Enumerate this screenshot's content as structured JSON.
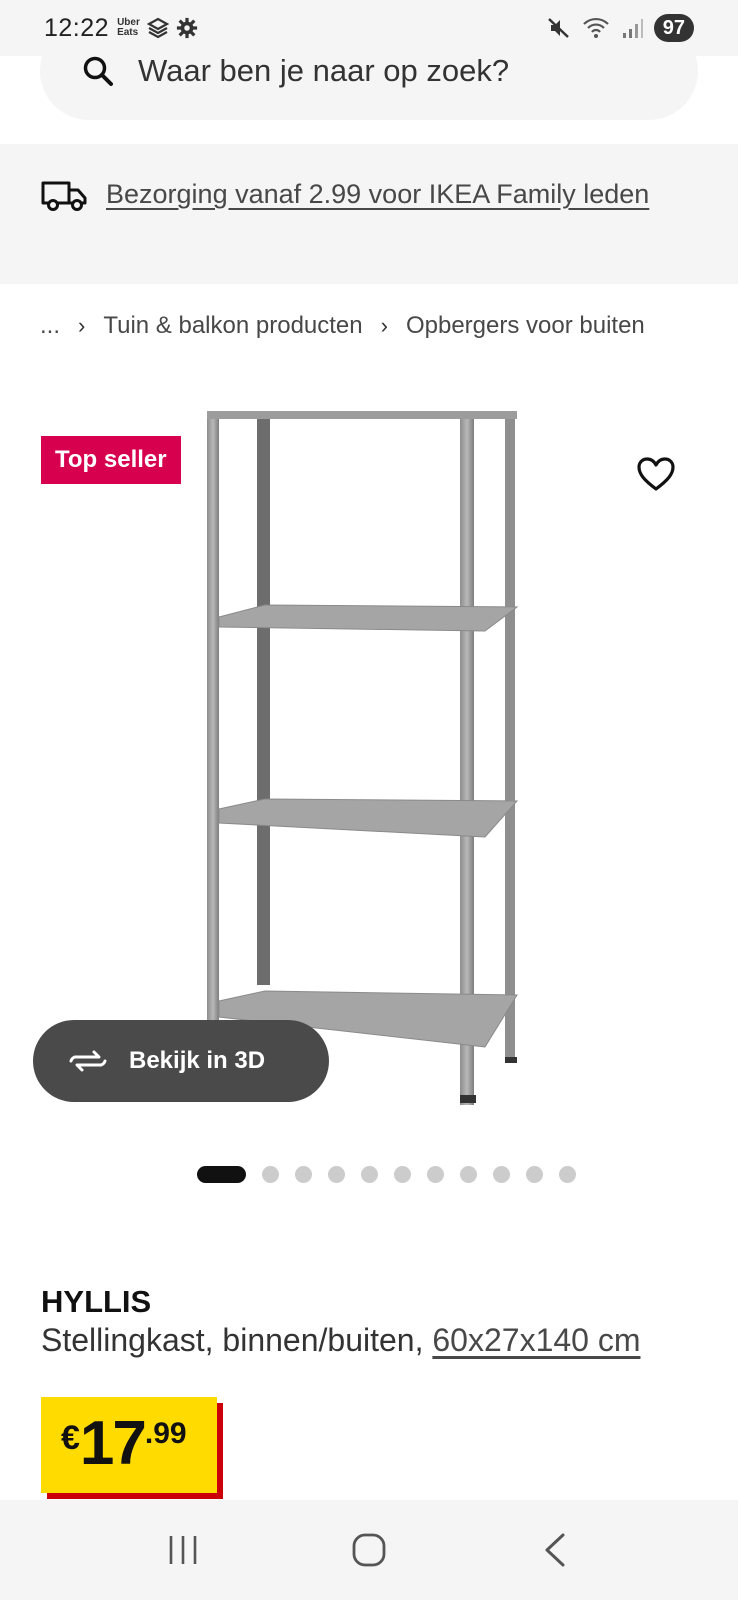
{
  "status_bar": {
    "time": "12:22",
    "notif_app": "Uber\nEats",
    "battery": "97"
  },
  "search": {
    "placeholder": "Waar ben je naar op zoek?"
  },
  "banner": {
    "text": "Bezorging vanaf 2.99 voor IKEA Family leden",
    "icon": "delivery-truck-icon"
  },
  "breadcrumb": {
    "ellipsis": "...",
    "items": [
      "Tuin & balkon producten",
      "Opbergers voor buiten"
    ],
    "separator": "›"
  },
  "gallery": {
    "badge": "Top seller",
    "view3d_label": "Bekijk in 3D",
    "image_count": 11,
    "active_index": 0
  },
  "product": {
    "name": "HYLLIS",
    "description": "Stellingkast, binnen/buiten, ",
    "dimensions": "60x27x140 cm",
    "price": {
      "currency": "€",
      "integer": "17",
      "decimal": ".99"
    }
  },
  "colors": {
    "badge": "#d6004f",
    "price_bg": "#ffdb00",
    "price_shadow": "#cc0008",
    "banner_bg": "#f5f5f5"
  }
}
